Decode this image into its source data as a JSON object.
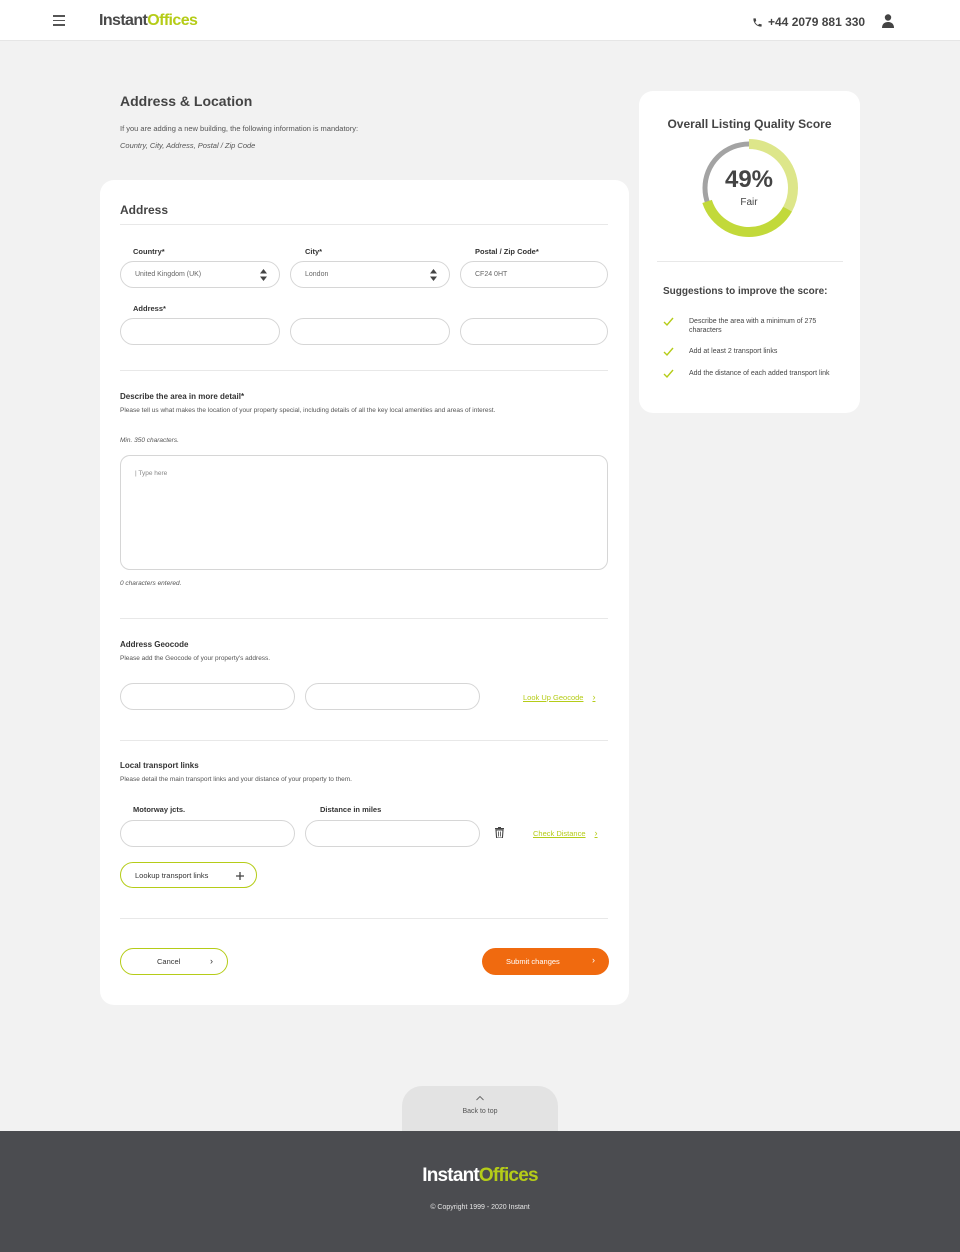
{
  "header": {
    "logo_part1": "Instant",
    "logo_part2": "Offices",
    "phone": "+44 2079 881 330"
  },
  "intro": {
    "title": "Address & Location",
    "text": "If you are adding a new building, the following information is mandatory:",
    "fields": "Country, City, Address, Postal / Zip Code"
  },
  "address": {
    "title": "Address",
    "country_label": "Country*",
    "country_value": "United Kingdom (UK)",
    "city_label": "City*",
    "city_value": "London",
    "postal_label": "Postal / Zip Code*",
    "postal_value": "CF24 0HT",
    "address_label": "Address*"
  },
  "describe": {
    "title": "Describe the area in more detail*",
    "text": "Please tell us what makes the location of your property special, including details of all the key local amenities and areas of interest.",
    "min_note": "Min. 350 characters.",
    "placeholder": "| Type here",
    "count_note": "0 characters entered."
  },
  "geocode": {
    "title": "Address Geocode",
    "text": "Please add the Geocode of your property's address.",
    "lookup_label": "Look Up Geocode"
  },
  "transport": {
    "title": "Local transport links",
    "text": "Please detail the main transport links and your distance of your property to them.",
    "motorway_label": "Motorway jcts.",
    "distance_label": "Distance in miles",
    "check_label": "Check Distance",
    "lookup_button": "Lookup transport links"
  },
  "actions": {
    "cancel": "Cancel",
    "submit": "Submit changes"
  },
  "score": {
    "title": "Overall Listing Quality Score",
    "percent": "49%",
    "percent_value": 49,
    "rating": "Fair",
    "suggestions_title": "Suggestions to improve the score:",
    "suggestions": [
      "Describe the area with a minimum of 275 characters",
      "Add at least 2 transport links",
      "Add the distance of each added transport link"
    ]
  },
  "footer": {
    "back_to_top": "Back to top",
    "logo_part1": "Instant",
    "logo_part2": "Offices",
    "copyright": "© Copyright 1999 - 2020 Instant"
  },
  "colors": {
    "brand_green": "#b5cc18",
    "submit_orange": "#f06a0f",
    "footer_bg": "#4b4c50"
  }
}
